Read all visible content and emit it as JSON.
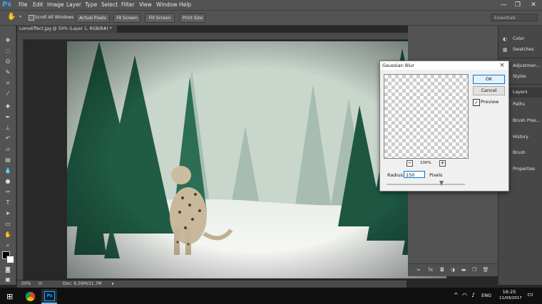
{
  "app": {
    "logo": "Ps"
  },
  "menu": [
    "File",
    "Edit",
    "Image",
    "Layer",
    "Type",
    "Select",
    "Filter",
    "View",
    "Window",
    "Help"
  ],
  "window_controls": {
    "minimize": "—",
    "restore": "❐",
    "close": "✕"
  },
  "options_bar": {
    "scroll_all_windows": "Scroll All Windows",
    "buttons": [
      "Actual Pixels",
      "Fit Screen",
      "Fill Screen",
      "Print Size"
    ],
    "workspace": "Essentials"
  },
  "document": {
    "tab_title": "LomoEffect.jpg @ 50% (Layer 1, RGB/8#) *",
    "zoom": "50%",
    "doc_size": "Doc: 6.59M/21.7M"
  },
  "dock": [
    {
      "label": "Color",
      "icon": "color-icon"
    },
    {
      "label": "Swatches",
      "icon": "swatches-icon"
    },
    {
      "label": "Adjustmen...",
      "icon": "adjustments-icon"
    },
    {
      "label": "Styles",
      "icon": "styles-icon"
    },
    {
      "label": "Layers",
      "icon": "layers-icon"
    },
    {
      "label": "Paths",
      "icon": "paths-icon"
    },
    {
      "label": "Brush Pres...",
      "icon": "brush-presets-icon"
    },
    {
      "label": "History",
      "icon": "history-icon"
    },
    {
      "label": "Brush",
      "icon": "brush-icon"
    },
    {
      "label": "Properties",
      "icon": "properties-icon"
    }
  ],
  "dialog": {
    "title": "Gaussian Blur",
    "ok": "OK",
    "cancel": "Cancel",
    "preview_label": "Preview",
    "preview_checked": true,
    "zoom": "100%",
    "radius_label": "Radius:",
    "radius_value": "150",
    "units": "Pixels",
    "slider_fraction": 0.7
  },
  "taskbar": {
    "language": "ENG",
    "time": "16:25",
    "date": "11/09/2017"
  }
}
